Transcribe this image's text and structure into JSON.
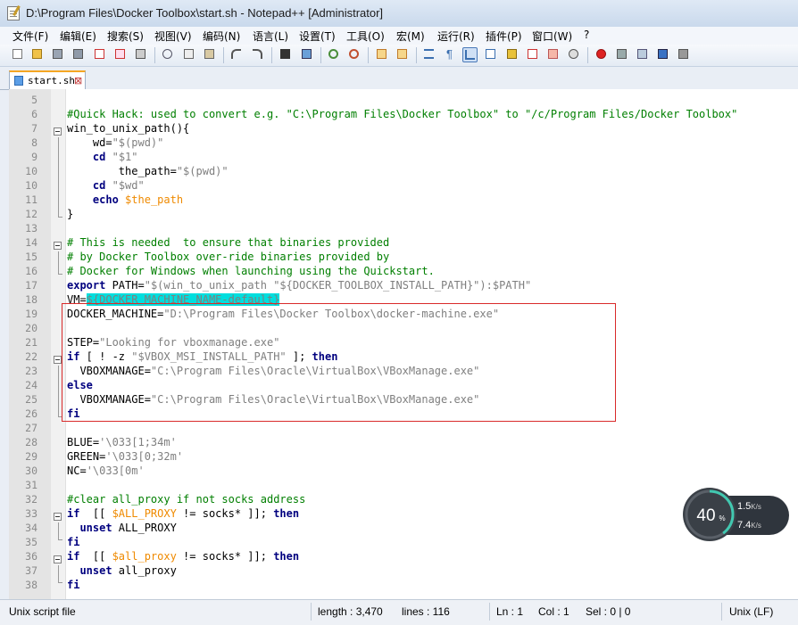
{
  "window": {
    "title": "D:\\Program Files\\Docker Toolbox\\start.sh - Notepad++ [Administrator]"
  },
  "menu": [
    "文件(F)",
    "编辑(E)",
    "搜索(S)",
    "视图(V)",
    "编码(N)",
    "语言(L)",
    "设置(T)",
    "工具(O)",
    "宏(M)",
    "运行(R)",
    "插件(P)",
    "窗口(W)",
    "?"
  ],
  "tab": {
    "label": "start.sh",
    "close": "⊠"
  },
  "lines": [
    {
      "n": "5",
      "t": [
        [
          "pl",
          ""
        ]
      ]
    },
    {
      "n": "6",
      "t": [
        [
          "cmt",
          "#Quick Hack: used to convert e.g. \"C:\\Program Files\\Docker Toolbox\" to \"/c/Program Files/Docker Toolbox\""
        ]
      ]
    },
    {
      "n": "7",
      "t": [
        [
          "pl",
          "win_to_unix_path(){"
        ]
      ]
    },
    {
      "n": "8",
      "t": [
        [
          "pl",
          "    wd="
        ],
        [
          "str",
          "\"$(pwd)\""
        ]
      ]
    },
    {
      "n": "9",
      "t": [
        [
          "pl",
          "    "
        ],
        [
          "kw",
          "cd"
        ],
        [
          "pl",
          " "
        ],
        [
          "str",
          "\"$1\""
        ]
      ]
    },
    {
      "n": "10",
      "t": [
        [
          "pl",
          "        the_path="
        ],
        [
          "str",
          "\"$(pwd)\""
        ]
      ]
    },
    {
      "n": "10b",
      "t": [
        [
          "pl",
          "    "
        ],
        [
          "kw",
          "cd"
        ],
        [
          "pl",
          " "
        ],
        [
          "str",
          "\"$wd\""
        ]
      ]
    },
    {
      "n": "11",
      "t": [
        [
          "pl",
          "    "
        ],
        [
          "kw",
          "echo"
        ],
        [
          "pl",
          " "
        ],
        [
          "var",
          "$the_path"
        ]
      ]
    },
    {
      "n": "12",
      "t": [
        [
          "pl",
          "}"
        ]
      ]
    },
    {
      "n": "13",
      "t": [
        [
          "pl",
          ""
        ]
      ]
    },
    {
      "n": "14",
      "t": [
        [
          "cmt",
          "# This is needed  to ensure that binaries provided"
        ]
      ]
    },
    {
      "n": "15",
      "t": [
        [
          "cmt",
          "# by Docker Toolbox over-ride binaries provided by"
        ]
      ]
    },
    {
      "n": "16",
      "t": [
        [
          "cmt",
          "# Docker for Windows when launching using the Quickstart."
        ]
      ]
    },
    {
      "n": "17",
      "t": [
        [
          "kw",
          "export"
        ],
        [
          "pl",
          " PATH="
        ],
        [
          "str",
          "\"$(win_to_unix_path \"${DOCKER_TOOLBOX_INSTALL_PATH}\"):$PATH\""
        ]
      ]
    },
    {
      "n": "18",
      "t": [
        [
          "pl",
          "VM="
        ],
        [
          "hl",
          "${DOCKER_MACHINE_NAME-default}"
        ]
      ]
    },
    {
      "n": "19",
      "t": [
        [
          "pl",
          "DOCKER_MACHINE="
        ],
        [
          "str",
          "\"D:\\Program Files\\Docker Toolbox\\docker-machine.exe\""
        ]
      ]
    },
    {
      "n": "20",
      "t": [
        [
          "pl",
          ""
        ]
      ]
    },
    {
      "n": "21",
      "t": [
        [
          "pl",
          "STEP="
        ],
        [
          "str",
          "\"Looking for vboxmanage.exe\""
        ]
      ]
    },
    {
      "n": "22",
      "t": [
        [
          "kw",
          "if"
        ],
        [
          "pl",
          " [ ! -z "
        ],
        [
          "str",
          "\"$VBOX_MSI_INSTALL_PATH\""
        ],
        [
          "pl",
          " ]; "
        ],
        [
          "kw",
          "then"
        ]
      ]
    },
    {
      "n": "23",
      "t": [
        [
          "pl",
          "  VBOXMANAGE="
        ],
        [
          "str",
          "\"C:\\Program Files\\Oracle\\VirtualBox\\VBoxManage.exe\""
        ]
      ]
    },
    {
      "n": "24",
      "t": [
        [
          "kw",
          "else"
        ]
      ]
    },
    {
      "n": "25",
      "t": [
        [
          "pl",
          "  VBOXMANAGE="
        ],
        [
          "str",
          "\"C:\\Program Files\\Oracle\\VirtualBox\\VBoxManage.exe\""
        ]
      ]
    },
    {
      "n": "26",
      "t": [
        [
          "kw",
          "fi"
        ]
      ]
    },
    {
      "n": "27",
      "t": [
        [
          "pl",
          ""
        ]
      ]
    },
    {
      "n": "28",
      "t": [
        [
          "pl",
          "BLUE="
        ],
        [
          "str",
          "'\\033[1;34m'"
        ]
      ]
    },
    {
      "n": "29",
      "t": [
        [
          "pl",
          "GREEN="
        ],
        [
          "str",
          "'\\033[0;32m'"
        ]
      ]
    },
    {
      "n": "30",
      "t": [
        [
          "pl",
          "NC="
        ],
        [
          "str",
          "'\\033[0m'"
        ]
      ]
    },
    {
      "n": "31",
      "t": [
        [
          "pl",
          ""
        ]
      ]
    },
    {
      "n": "32",
      "t": [
        [
          "cmt",
          "#clear all_proxy if not socks address"
        ]
      ]
    },
    {
      "n": "33",
      "t": [
        [
          "kw",
          "if"
        ],
        [
          "pl",
          "  [[ "
        ],
        [
          "var",
          "$ALL_PROXY"
        ],
        [
          "pl",
          " != socks* ]]; "
        ],
        [
          "kw",
          "then"
        ]
      ]
    },
    {
      "n": "34",
      "t": [
        [
          "pl",
          "  "
        ],
        [
          "kw",
          "unset"
        ],
        [
          "pl",
          " ALL_PROXY"
        ]
      ]
    },
    {
      "n": "35",
      "t": [
        [
          "kw",
          "fi"
        ]
      ]
    },
    {
      "n": "36",
      "t": [
        [
          "kw",
          "if"
        ],
        [
          "pl",
          "  [[ "
        ],
        [
          "var",
          "$all_proxy"
        ],
        [
          "pl",
          " != socks* ]]; "
        ],
        [
          "kw",
          "then"
        ]
      ]
    },
    {
      "n": "37",
      "t": [
        [
          "pl",
          "  "
        ],
        [
          "kw",
          "unset"
        ],
        [
          "pl",
          " all_proxy"
        ]
      ]
    },
    {
      "n": "38",
      "t": [
        [
          "kw",
          "fi"
        ]
      ]
    }
  ],
  "status": {
    "filetype": "Unix script file",
    "length": "length : 3,470",
    "lines": "lines : 116",
    "ln": "Ln : 1",
    "col": "Col : 1",
    "sel": "Sel : 0 | 0",
    "eol": "Unix (LF)"
  },
  "net": {
    "percent": "40",
    "percent_sign": "%",
    "up": "1.5",
    "down": "7.4",
    "unit": "K/s",
    "load": 0.4
  },
  "colors": {
    "keyword": "#00007f",
    "string": "#7f7f7f",
    "comment": "#007f00",
    "variable": "#ef8a00",
    "highlight": "#00dede",
    "tab_accent": "#f5a623",
    "annotation_box": "#d92b2b"
  }
}
